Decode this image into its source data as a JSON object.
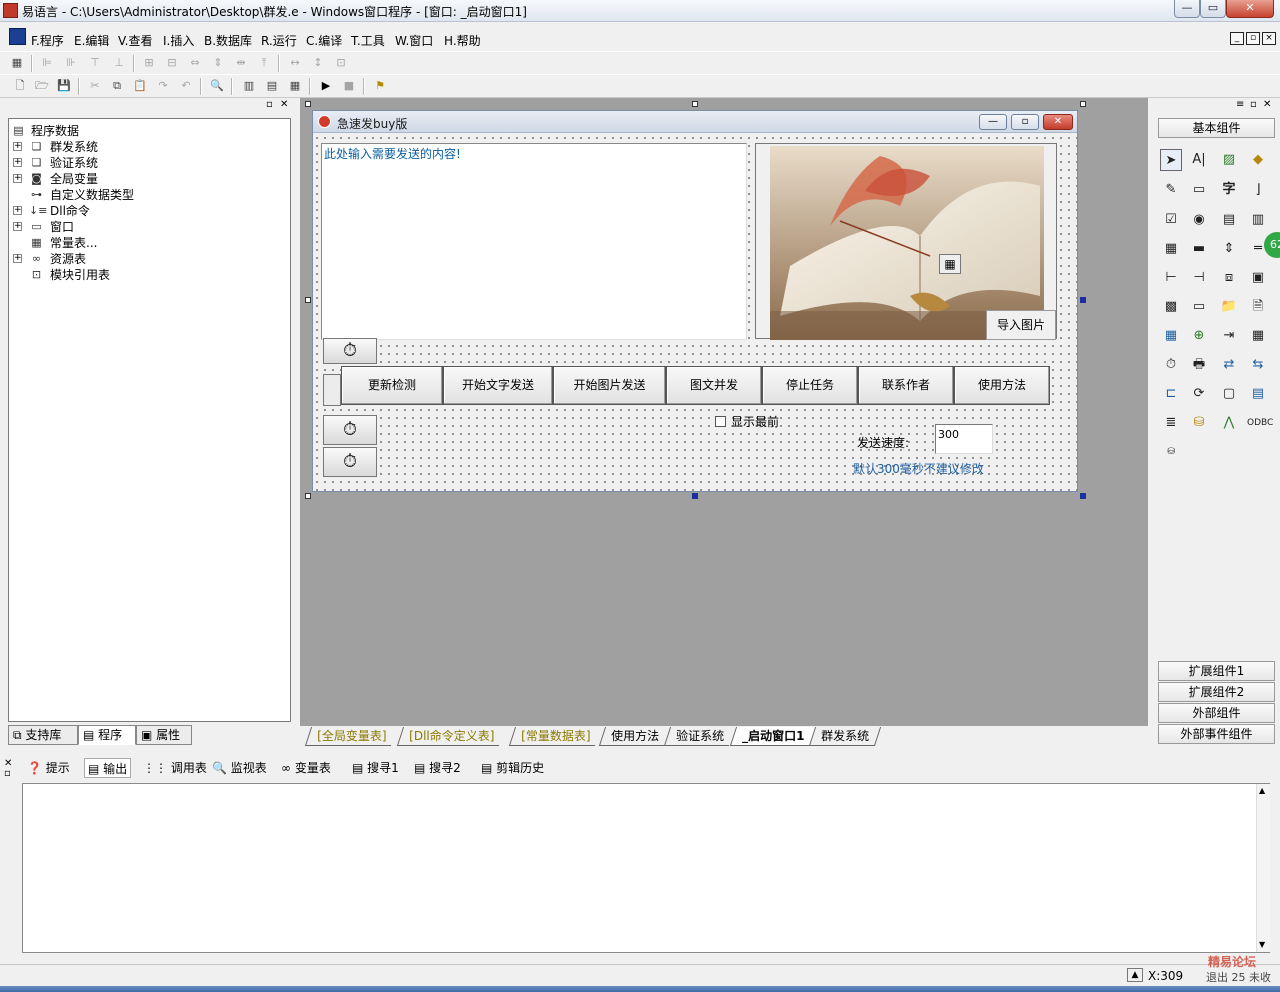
{
  "app": {
    "title": "易语言 - C:\\Users\\Administrator\\Desktop\\群发.e - Windows窗口程序 - [窗口: _启动窗口1]"
  },
  "window_buttons": {
    "minimize": "—",
    "restore": "▭",
    "close": "✕"
  },
  "menu": {
    "items": [
      "F.程序",
      "E.编辑",
      "V.查看",
      "I.插入",
      "B.数据库",
      "R.运行",
      "C.编译",
      "T.工具",
      "W.窗口",
      "H.帮助"
    ]
  },
  "tree": {
    "root": "程序数据",
    "items": [
      {
        "label": "群发系统",
        "icon": "books-icon",
        "expander": "+"
      },
      {
        "label": "验证系统",
        "icon": "books-icon",
        "expander": "+"
      },
      {
        "label": "全局变量",
        "icon": "jar-icon",
        "expander": "+"
      },
      {
        "label": "自定义数据类型",
        "icon": "type-icon",
        "expander": ""
      },
      {
        "label": "Dll命令",
        "icon": "dll-icon",
        "expander": "+"
      },
      {
        "label": "窗口",
        "icon": "window-icon",
        "expander": "+"
      },
      {
        "label": "常量表...",
        "icon": "constant-icon",
        "expander": ""
      },
      {
        "label": "资源表",
        "icon": "resource-icon",
        "expander": "+"
      },
      {
        "label": "模块引用表",
        "icon": "module-icon",
        "expander": ""
      }
    ]
  },
  "left_tabs": [
    "支持库",
    "程序",
    "属性"
  ],
  "form": {
    "title": "急速发buy版",
    "textarea_value": "此处输入需要发送的内容!",
    "import_image_label": "导入图片",
    "buttons": [
      "更新检测",
      "开始文字发送",
      "开始图片发送",
      "图文并发",
      "停止任务",
      "联系作者",
      "使用方法"
    ],
    "topmost_label": "显示最前",
    "speed_label": "发送速度:",
    "speed_value": "300",
    "hint": "默认300毫秒不建议修改"
  },
  "right_panel": {
    "basic_header": "基本组件",
    "footer_headers": [
      "扩展组件1",
      "扩展组件2",
      "外部组件",
      "外部事件组件"
    ],
    "badge": "62"
  },
  "bottom_tabs": [
    {
      "label": "[全局变量表]",
      "color": "#8a7a00"
    },
    {
      "label": "[Dll命令定义表]",
      "color": "#8a7a00"
    },
    {
      "label": "[常量数据表]",
      "color": "#8a7a00"
    },
    {
      "label": "使用方法",
      "color": "#000000"
    },
    {
      "label": "验证系统",
      "color": "#000000"
    },
    {
      "label": "_启动窗口1",
      "color": "#000000",
      "active": true
    },
    {
      "label": "群发系统",
      "color": "#000000"
    }
  ],
  "output_tabs": [
    "提示",
    "输出",
    "调用表",
    "监视表",
    "变量表",
    "搜寻1",
    "搜寻2",
    "剪辑历史"
  ],
  "status": {
    "coord": "X:309",
    "watermark_top": "精易论坛",
    "watermark_bottom": "退出 25 未收"
  }
}
